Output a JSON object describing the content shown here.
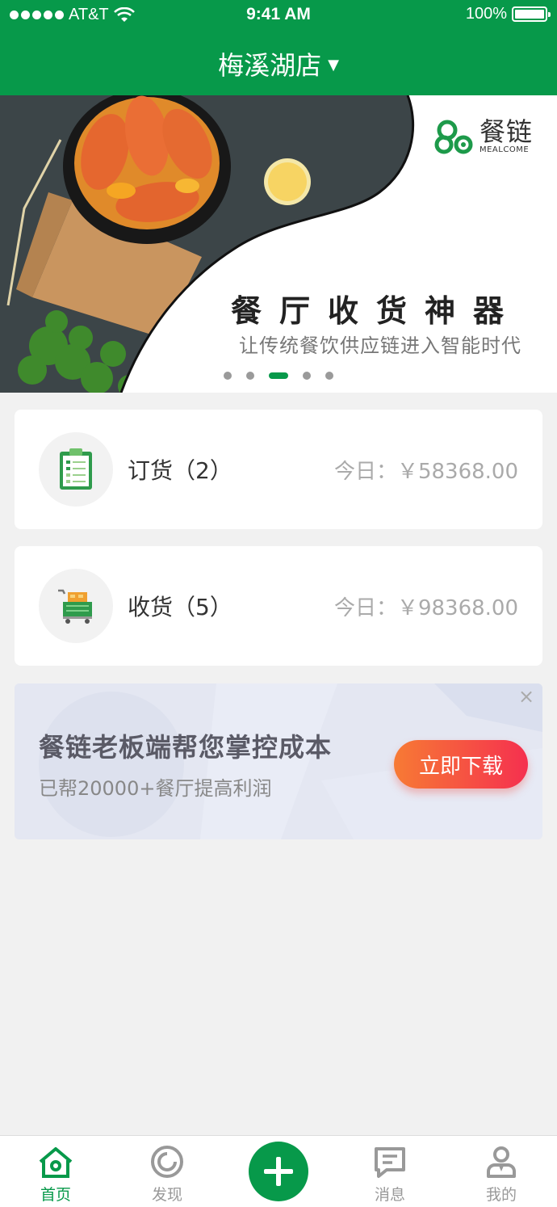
{
  "status_bar": {
    "carrier": "AT&T",
    "time": "9:41 AM",
    "battery": "100%"
  },
  "header": {
    "store_name": "梅溪湖店",
    "dropdown_arrow": "▼"
  },
  "banner": {
    "brand_cn": "餐链",
    "brand_en": "MEALCOME",
    "title": "餐厅收货神器",
    "subtitle": "让传统餐饮供应链进入智能时代",
    "slide_count": 5,
    "active_slide": 2
  },
  "cards": [
    {
      "icon": "clipboard-icon",
      "label": "订货（2）",
      "amount": "今日：￥58368.00"
    },
    {
      "icon": "cart-icon",
      "label": "收货（5）",
      "amount": "今日：￥98368.00"
    }
  ],
  "promo": {
    "title": "餐链老板端帮您掌控成本",
    "subtitle": "已帮20000+餐厅提高利润",
    "button": "立即下载",
    "close": "×"
  },
  "tabbar": {
    "items": [
      {
        "label": "首页",
        "icon": "home-icon",
        "active": true
      },
      {
        "label": "发现",
        "icon": "discover-icon",
        "active": false
      },
      {
        "label": "",
        "icon": "plus-icon",
        "active": false
      },
      {
        "label": "消息",
        "icon": "message-icon",
        "active": false
      },
      {
        "label": "我的",
        "icon": "profile-icon",
        "active": false
      }
    ]
  },
  "colors": {
    "brand_green": "#07994a",
    "button_gradient_start": "#f77a34",
    "button_gradient_end": "#f5304f"
  }
}
